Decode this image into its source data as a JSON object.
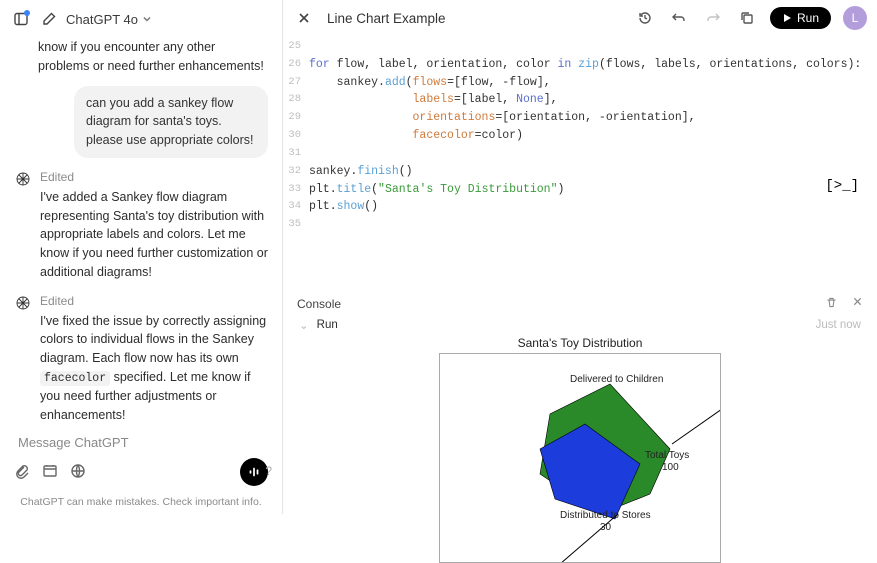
{
  "chat": {
    "model": "ChatGPT 4o",
    "prev_assistant_tail": "know if you encounter any other problems or need further enhancements!",
    "user_msg": "can you add a sankey flow diagram for santa's toys. please use appropriate colors!",
    "msg2": {
      "tag": "Edited",
      "text": "I've added a Sankey flow diagram representing Santa's toy distribution with appropriate labels and colors. Let me know if you need further customization or additional diagrams!"
    },
    "msg3": {
      "tag": "Edited",
      "text_a": "I've fixed the issue by correctly assigning colors to individual flows in the Sankey diagram. Each flow now has its own ",
      "code": "facecolor",
      "text_b": " specified. Let me know if you need further adjustments or enhancements!"
    },
    "placeholder": "Message ChatGPT",
    "footer": "ChatGPT can make mistakes. Check important info."
  },
  "editor": {
    "title": "Line Chart Example",
    "run_label": "Run",
    "avatar_initial": "L",
    "lines": [
      25,
      26,
      27,
      28,
      29,
      30,
      31,
      32,
      33,
      34,
      35
    ]
  },
  "console": {
    "label": "Console",
    "run": "Run",
    "time": "Just now"
  },
  "chart_data": {
    "type": "sankey",
    "title": "Santa's Toy Distribution",
    "nodes": [
      "Total Toys",
      "Delivered to Children",
      "Distributed to Stores"
    ],
    "flows": [
      {
        "from": "Total Toys",
        "to": "Delivered to Children",
        "value": 100,
        "color": "green"
      },
      {
        "from": "Total Toys",
        "to": "Distributed to Stores",
        "value": 30,
        "color": "blue"
      }
    ],
    "labels_visible": {
      "total": "Total Toys",
      "total_val": "100",
      "delivered": "Delivered to Children",
      "stores": "Distributed to Stores",
      "stores_val": "30"
    }
  }
}
